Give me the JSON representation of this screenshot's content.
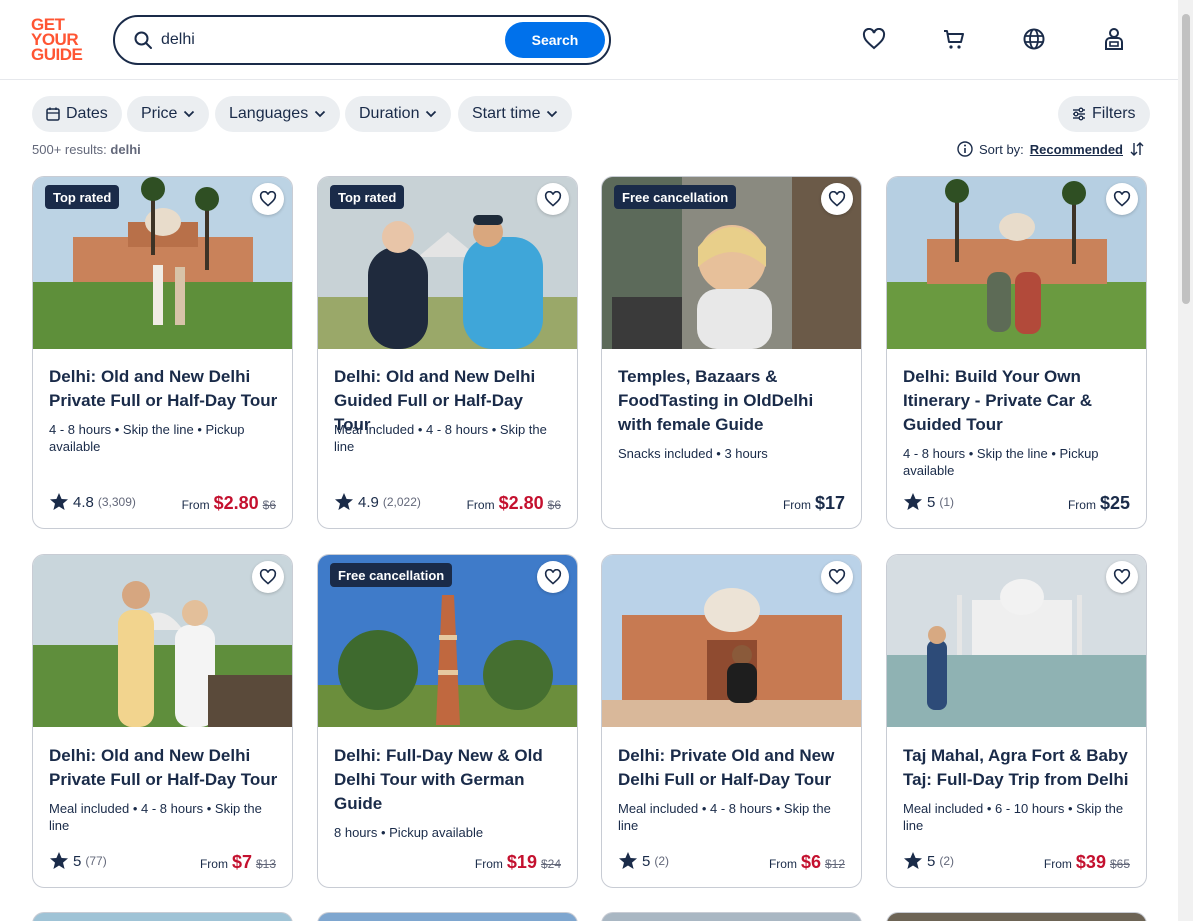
{
  "header": {
    "logo_lines": [
      "GET",
      "YOUR",
      "GUIDE"
    ],
    "search_value": "delhi",
    "search_button": "Search"
  },
  "filters": [
    "Dates",
    "Price",
    "Languages",
    "Duration",
    "Start time"
  ],
  "filters_button": "Filters",
  "results_prefix": "500+ results:",
  "results_query": "delhi",
  "sort_label": "Sort by:",
  "sort_value": "Recommended",
  "colors": {
    "brand": "#ff5533",
    "accent": "#0071eb",
    "price": "#c4112f",
    "navy": "#1a2b49"
  },
  "cards": [
    {
      "badge": "Top rated",
      "title": "Delhi: Old and New Delhi Private Full or Half-Day Tour",
      "meta": "4 - 8 hours • Skip the line • Pickup available",
      "rating": "4.8",
      "count": "(3,309)",
      "from": "From",
      "price": "$2.80",
      "old": "$6",
      "sale": true
    },
    {
      "badge": "Top rated",
      "title": "Delhi: Old and New Delhi Guided Full or Half-Day Tour",
      "meta": "Meal included • 4 - 8 hours • Skip the line",
      "rating": "4.9",
      "count": "(2,022)",
      "from": "From",
      "price": "$2.80",
      "old": "$6",
      "sale": true
    },
    {
      "badge": "Free cancellation",
      "title": "Temples, Bazaars & FoodTasting in OldDelhi with female Guide",
      "meta": "Snacks included • 3 hours",
      "rating": "",
      "count": "",
      "from": "From",
      "price": "$17",
      "old": "",
      "sale": false
    },
    {
      "badge": "",
      "title": "Delhi: Build Your Own Itinerary - Private Car & Guided Tour",
      "meta": "4 - 8 hours • Skip the line • Pickup available",
      "rating": "5",
      "count": "(1)",
      "from": "From",
      "price": "$25",
      "old": "",
      "sale": false
    },
    {
      "badge": "",
      "title": "Delhi: Old and New Delhi Private Full or Half-Day Tour",
      "meta": "Meal included • 4 - 8 hours • Skip the line",
      "rating": "5",
      "count": "(77)",
      "from": "From",
      "price": "$7",
      "old": "$13",
      "sale": true
    },
    {
      "badge": "Free cancellation",
      "title": "Delhi: Full-Day New & Old Delhi Tour with German Guide",
      "meta": "8 hours • Pickup available",
      "rating": "",
      "count": "",
      "from": "From",
      "price": "$19",
      "old": "$24",
      "sale": true
    },
    {
      "badge": "",
      "title": "Delhi: Private Old and New Delhi Full or Half-Day Tour",
      "meta": "Meal included • 4 - 8 hours • Skip the line",
      "rating": "5",
      "count": "(2)",
      "from": "From",
      "price": "$6",
      "old": "$12",
      "sale": true
    },
    {
      "badge": "",
      "title": "Taj Mahal, Agra Fort & Baby Taj: Full-Day Trip from Delhi",
      "meta": "Meal included • 6 - 10 hours • Skip the line",
      "rating": "5",
      "count": "(2)",
      "from": "From",
      "price": "$39",
      "old": "$65",
      "sale": true
    }
  ]
}
